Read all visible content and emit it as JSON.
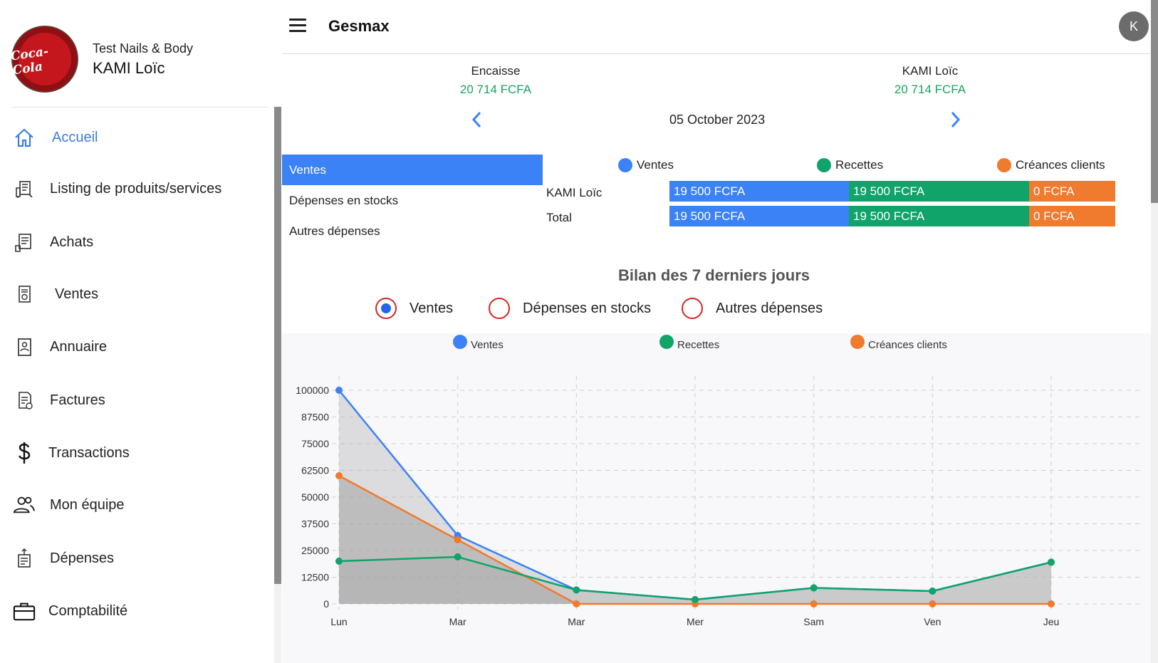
{
  "sidebar": {
    "company": "Test Nails & Body",
    "user_name": "KAMI Loïc",
    "logo_text": "Coca-Cola",
    "items": [
      {
        "label": "Accueil",
        "icon": "home-icon",
        "active": true
      },
      {
        "label": "Listing de produits/services",
        "icon": "products-icon",
        "active": false
      },
      {
        "label": "Achats",
        "icon": "purchases-icon",
        "active": false
      },
      {
        "label": "Ventes",
        "icon": "sales-icon",
        "active": false
      },
      {
        "label": "Annuaire",
        "icon": "directory-icon",
        "active": false
      },
      {
        "label": "Factures",
        "icon": "invoice-icon",
        "active": false
      },
      {
        "label": "Transactions",
        "icon": "dollar-icon",
        "active": false
      },
      {
        "label": "Mon équipe",
        "icon": "team-icon",
        "active": false
      },
      {
        "label": "Dépenses",
        "icon": "expenses-icon",
        "active": false
      },
      {
        "label": "Comptabilité",
        "icon": "briefcase-icon",
        "active": false
      }
    ]
  },
  "header": {
    "title": "Gesmax",
    "user_initial": "K"
  },
  "summary": {
    "left_label": "Encaisse",
    "left_value": "20 714 FCFA",
    "right_label": "KAMI Loïc",
    "right_value": "20 714 FCFA",
    "date": "05 October 2023"
  },
  "tabs": [
    {
      "label": "Ventes",
      "active": true
    },
    {
      "label": "Dépenses en stocks",
      "active": false
    },
    {
      "label": "Autres dépenses",
      "active": false
    }
  ],
  "stats": {
    "legend": [
      "Ventes",
      "Recettes",
      "Créances clients"
    ],
    "rows": [
      {
        "label": "KAMI Loïc",
        "ventes": "19 500 FCFA",
        "recettes": "19 500 FCFA",
        "creances": "0 FCFA"
      },
      {
        "label": "Total",
        "ventes": "19 500 FCFA",
        "recettes": "19 500 FCFA",
        "creances": "0 FCFA"
      }
    ]
  },
  "bilan": {
    "title": "Bilan des 7 derniers jours",
    "options": [
      {
        "label": "Ventes",
        "selected": true
      },
      {
        "label": "Dépenses en stocks",
        "selected": false
      },
      {
        "label": "Autres dépenses",
        "selected": false
      }
    ]
  },
  "colors": {
    "accent_blue": "#3b82f6",
    "green": "#10a36a",
    "orange": "#f07a2e",
    "active_link": "#3b7ddd"
  },
  "chart_data": {
    "type": "line",
    "categories": [
      "Lun",
      "Mar",
      "Mar",
      "Mer",
      "Sam",
      "Ven",
      "Jeu"
    ],
    "ylim": [
      0,
      100000
    ],
    "yticks": [
      0,
      12500,
      25000,
      37500,
      50000,
      62500,
      75000,
      87500,
      100000
    ],
    "legend": "top",
    "grid": true,
    "series": [
      {
        "name": "Ventes",
        "color": "#3b82f6",
        "values": [
          100000,
          32000,
          6500,
          2000,
          7500,
          6000,
          19500
        ]
      },
      {
        "name": "Recettes",
        "color": "#10a36a",
        "values": [
          20000,
          22000,
          6500,
          2000,
          7500,
          6000,
          19500
        ]
      },
      {
        "name": "Créances clients",
        "color": "#f07a2e",
        "values": [
          60000,
          30000,
          0,
          0,
          0,
          0,
          0
        ]
      }
    ]
  }
}
